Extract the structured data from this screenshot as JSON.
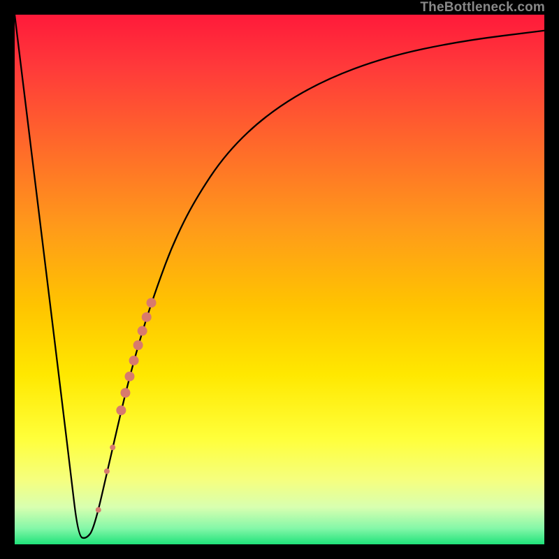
{
  "watermark": "TheBottleneck.com",
  "chart_data": {
    "type": "line",
    "title": "",
    "xlabel": "",
    "ylabel": "",
    "xlim": [
      0,
      100
    ],
    "ylim": [
      0,
      100
    ],
    "series": [
      {
        "name": "curve",
        "x": [
          0,
          3,
          6,
          9,
          10.5,
          12,
          13.5,
          15,
          18,
          21,
          24,
          27,
          30,
          34,
          40,
          48,
          58,
          70,
          84,
          100
        ],
        "y": [
          100,
          75.5,
          51,
          26.5,
          14,
          1.5,
          1,
          3,
          16,
          29,
          40,
          49,
          57,
          65,
          74,
          81.5,
          87.5,
          92,
          95,
          97
        ]
      }
    ],
    "markers": {
      "name": "highlight-dots",
      "color": "#d87a6d",
      "points": [
        {
          "x": 15.8,
          "y": 6.5,
          "r": 4
        },
        {
          "x": 17.4,
          "y": 13.8,
          "r": 4
        },
        {
          "x": 18.5,
          "y": 18.3,
          "r": 4
        },
        {
          "x": 20.1,
          "y": 25.3,
          "r": 7
        },
        {
          "x": 20.9,
          "y": 28.6,
          "r": 7
        },
        {
          "x": 21.7,
          "y": 31.7,
          "r": 7
        },
        {
          "x": 22.5,
          "y": 34.7,
          "r": 7
        },
        {
          "x": 23.3,
          "y": 37.6,
          "r": 7
        },
        {
          "x": 24.1,
          "y": 40.3,
          "r": 7
        },
        {
          "x": 24.9,
          "y": 42.9,
          "r": 7
        },
        {
          "x": 25.8,
          "y": 45.6,
          "r": 7
        }
      ]
    }
  }
}
